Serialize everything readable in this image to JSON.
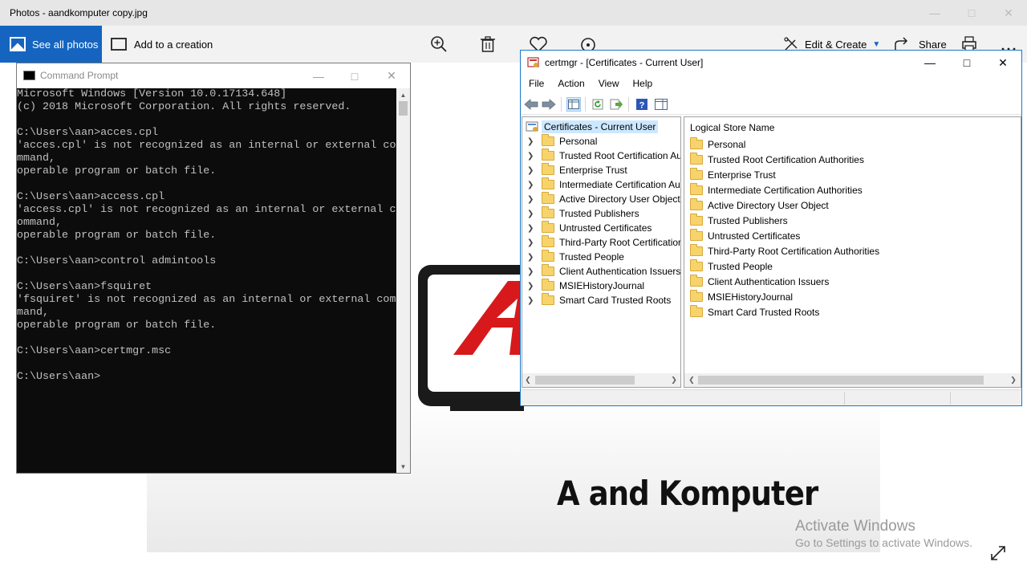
{
  "photos": {
    "window_title": "Photos - aandkomputer copy.jpg",
    "toolbar": {
      "see_all_label": "See all photos",
      "add_creation_label": "Add to a creation",
      "edit_create_label": "Edit & Create",
      "share_label": "Share"
    },
    "photo_caption": "A and Komputer",
    "activation": {
      "line1": "Activate Windows",
      "line2": "Go to Settings to activate Windows."
    },
    "colors": {
      "accent": "#1565c0",
      "logo_red": "#d7191c"
    }
  },
  "cmd": {
    "title": "Command Prompt",
    "lines": [
      "Microsoft Windows [Version 10.0.17134.648]",
      "(c) 2018 Microsoft Corporation. All rights reserved.",
      "",
      "C:\\Users\\aan>acces.cpl",
      "'acces.cpl' is not recognized as an internal or external co",
      "mmand,",
      "operable program or batch file.",
      "",
      "C:\\Users\\aan>access.cpl",
      "'access.cpl' is not recognized as an internal or external c",
      "ommand,",
      "operable program or batch file.",
      "",
      "C:\\Users\\aan>control admintools",
      "",
      "C:\\Users\\aan>fsquiret",
      "'fsquiret' is not recognized as an internal or external com",
      "mand,",
      "operable program or batch file.",
      "",
      "C:\\Users\\aan>certmgr.msc",
      "",
      "C:\\Users\\aan>"
    ]
  },
  "certmgr": {
    "title": "certmgr - [Certificates - Current User]",
    "menu": [
      "File",
      "Action",
      "View",
      "Help"
    ],
    "tree_root": "Certificates - Current User",
    "tree_items": [
      "Personal",
      "Trusted Root Certification Au",
      "Enterprise Trust",
      "Intermediate Certification Au",
      "Active Directory User Object",
      "Trusted Publishers",
      "Untrusted Certificates",
      "Third-Party Root Certificatior",
      "Trusted People",
      "Client Authentication Issuers",
      "MSIEHistoryJournal",
      "Smart Card Trusted Roots"
    ],
    "list_header": "Logical Store Name",
    "list_items": [
      "Personal",
      "Trusted Root Certification Authorities",
      "Enterprise Trust",
      "Intermediate Certification Authorities",
      "Active Directory User Object",
      "Trusted Publishers",
      "Untrusted Certificates",
      "Third-Party Root Certification Authorities",
      "Trusted People",
      "Client Authentication Issuers",
      "MSIEHistoryJournal",
      "Smart Card Trusted Roots"
    ]
  }
}
